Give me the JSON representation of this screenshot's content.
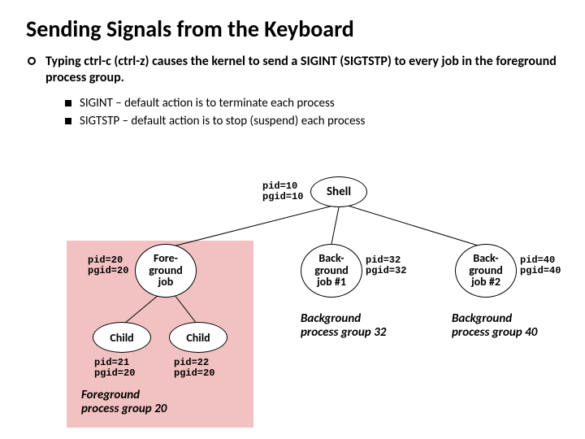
{
  "title": "Sending Signals from the Keyboard",
  "bullets": {
    "b1": "Typing ctrl-c (ctrl-z) causes the kernel to send a SIGINT (SIGTSTP) to every job in the foreground process group.",
    "b1a": "SIGINT – default action is to terminate each process",
    "b1b": "SIGTSTP – default action is to stop (suspend) each process"
  },
  "nodes": {
    "shell": "Shell",
    "fg": "Fore-\nground\njob",
    "bg1": "Back-\nground\njob #1",
    "bg2": "Back-\nground\njob #2",
    "child1": "Child",
    "child2": "Child"
  },
  "labels": {
    "shell": "pid=10\npgid=10",
    "fg": "pid=20\npgid=20",
    "bg1": "pid=32\npgid=32",
    "bg2": "pid=40\npgid=40",
    "child1": "pid=21\npgid=20",
    "child2": "pid=22\npgid=20"
  },
  "captions": {
    "fg": "Foreground\nprocess group 20",
    "bg1": "Background\nprocess group 32",
    "bg2": "Background\nprocess group 40"
  }
}
